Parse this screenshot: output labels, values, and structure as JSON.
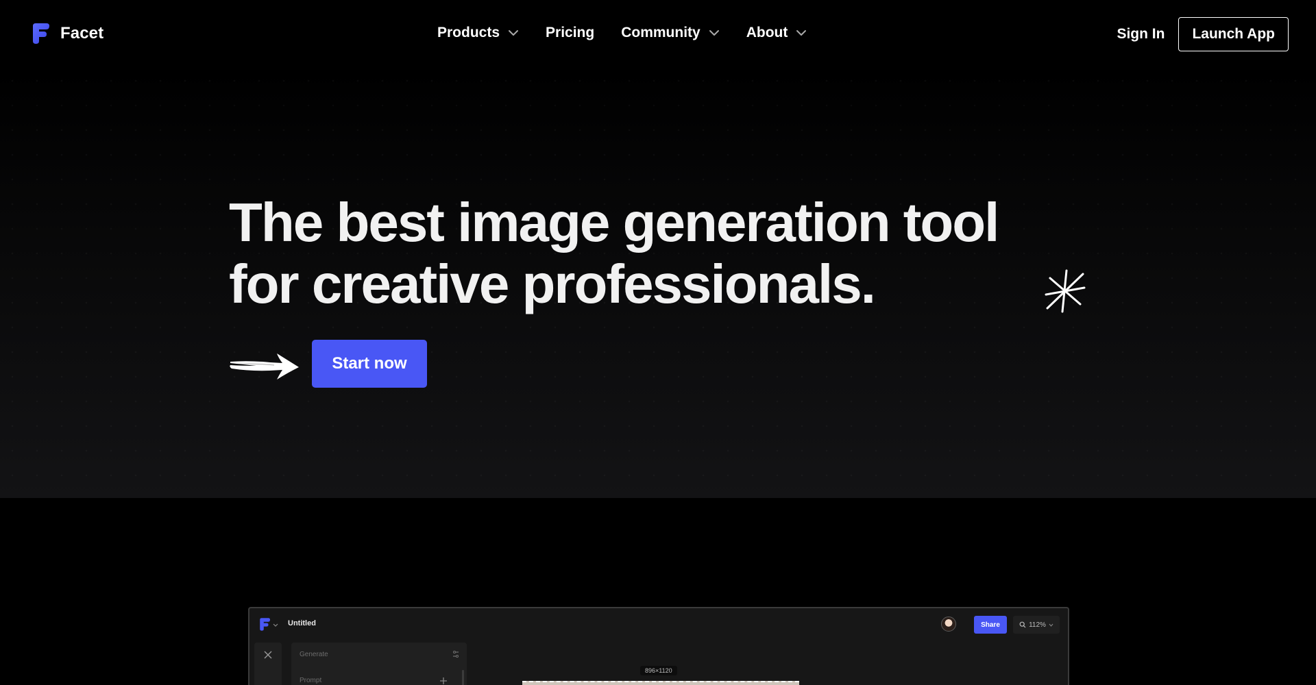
{
  "brand": {
    "name": "Facet",
    "accent_color": "#4957f5"
  },
  "nav": {
    "items": [
      {
        "label": "Products",
        "has_dropdown": true
      },
      {
        "label": "Pricing",
        "has_dropdown": false
      },
      {
        "label": "Community",
        "has_dropdown": true
      },
      {
        "label": "About",
        "has_dropdown": true
      }
    ],
    "sign_in": "Sign In",
    "launch_app": "Launch App"
  },
  "hero": {
    "title_line1": "The best image generation tool",
    "title_line2": "for creative professionals.",
    "cta": "Start now",
    "decor_icons": [
      "arrow-right-icon",
      "sparkle-icon"
    ]
  },
  "app_preview": {
    "doc_title": "Untitled",
    "share_label": "Share",
    "zoom": "112%",
    "panel_title": "Generate",
    "prompt_label": "Prompt",
    "canvas_dims": "896×1120"
  }
}
